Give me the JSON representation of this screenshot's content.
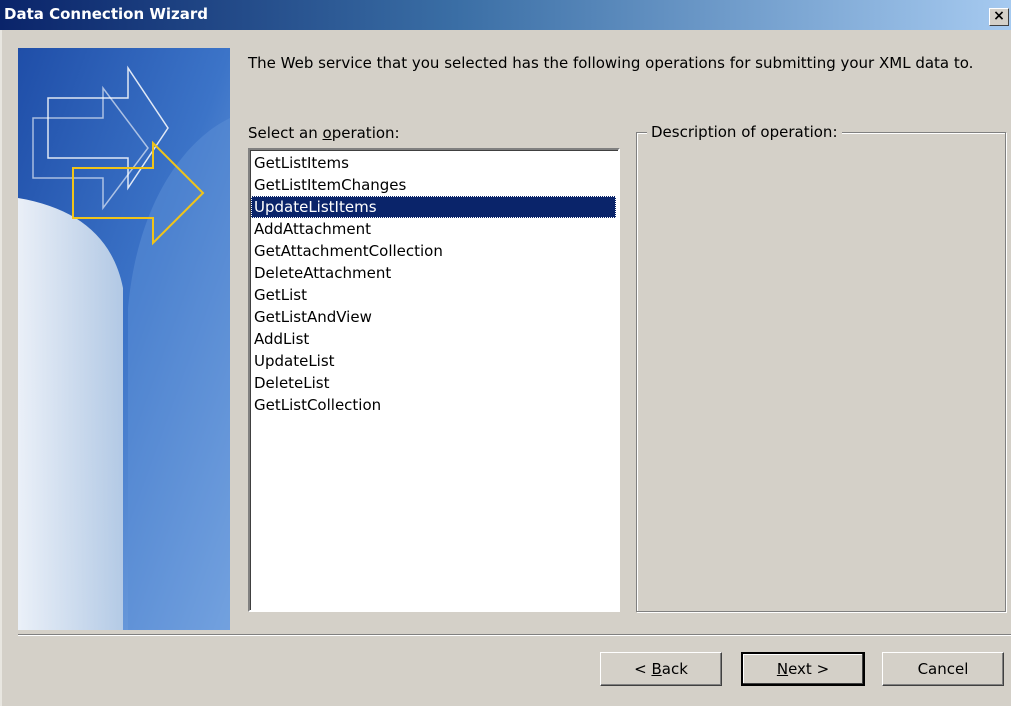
{
  "window": {
    "title": "Data Connection Wizard",
    "close_glyph": "×"
  },
  "intro_text": "The Web service that you selected has the following operations for submitting your XML data to.",
  "operation_list": {
    "label_before": "Select an ",
    "label_accel": "o",
    "label_after": "peration:",
    "selected": "UpdateListItems",
    "items": [
      "GetListItems",
      "GetListItemChanges",
      "UpdateListItems",
      "AddAttachment",
      "GetAttachmentCollection",
      "DeleteAttachment",
      "GetList",
      "GetListAndView",
      "AddList",
      "UpdateList",
      "DeleteList",
      "GetListCollection"
    ]
  },
  "description": {
    "legend": "Description of operation:"
  },
  "buttons": {
    "back_prefix": "< ",
    "back_accel": "B",
    "back_rest": "ack",
    "next_accel": "N",
    "next_rest": "ext >",
    "cancel": "Cancel"
  },
  "colors": {
    "title_bar": "#0a246a",
    "dialog_bg": "#d4d0c8",
    "selection": "#0a246a"
  },
  "icons": {
    "banner": "wizard-arrows-banner",
    "close": "close-icon"
  }
}
